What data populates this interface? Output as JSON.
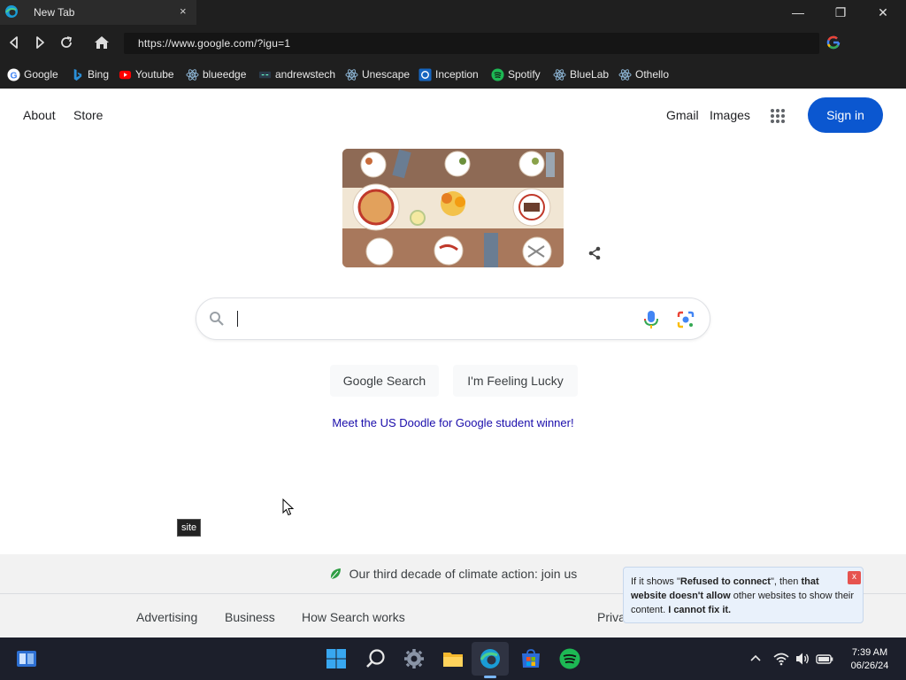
{
  "browser": {
    "tab_title": "New Tab",
    "tab_close": "×",
    "url": "https://www.google.com/?igu=1",
    "window_controls": {
      "minimize": "—",
      "restore": "❐",
      "close": "✕"
    }
  },
  "bookmarks": [
    {
      "label": "Google",
      "icon": "google-icon"
    },
    {
      "label": "Bing",
      "icon": "bing-icon"
    },
    {
      "label": "Youtube",
      "icon": "youtube-icon"
    },
    {
      "label": "blueedge",
      "icon": "react-icon"
    },
    {
      "label": "andrewstech",
      "icon": "site-icon"
    },
    {
      "label": "Unescape",
      "icon": "react-icon"
    },
    {
      "label": "Inception",
      "icon": "inception-icon"
    },
    {
      "label": "Spotify",
      "icon": "spotify-icon"
    },
    {
      "label": "BlueLab",
      "icon": "react-icon"
    },
    {
      "label": "Othello",
      "icon": "react-icon"
    }
  ],
  "header": {
    "about": "About",
    "store": "Store",
    "gmail": "Gmail",
    "images": "Images",
    "sign_in": "Sign in"
  },
  "search": {
    "value": "",
    "google_search": "Google Search",
    "feeling_lucky": "I'm Feeling Lucky",
    "promo": "Meet the US Doodle for Google student winner!"
  },
  "tooltip": "site",
  "footer": {
    "climate": "Our third decade of climate action: join us",
    "links_left": [
      "Advertising",
      "Business",
      "How Search works"
    ],
    "links_right_partial": "Priva"
  },
  "notice": {
    "part1": "If it shows \"",
    "bold1": "Refused to connect",
    "part2": "\", then ",
    "bold2": "that website doesn't allow",
    "part3": " other websites to show their content. ",
    "bold3": "I cannot fix it.",
    "close": "x"
  },
  "taskbar": {
    "time": "7:39 AM",
    "date": "06/26/24"
  },
  "colors": {
    "signin_blue": "#0b57d0",
    "chrome_dark": "#1f1f1f",
    "taskbar": "#1c1f2b",
    "link_blue": "#1a0dab"
  }
}
